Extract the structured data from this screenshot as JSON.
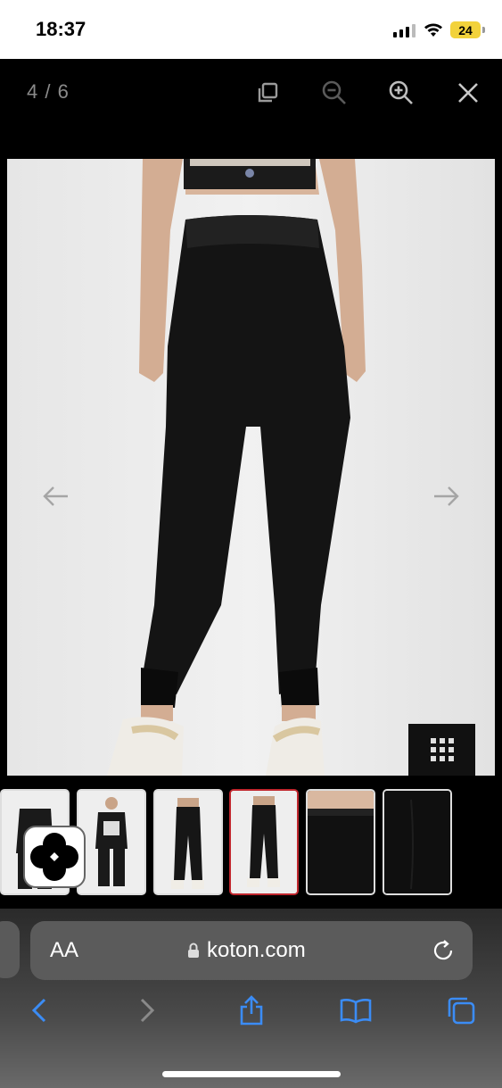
{
  "status_bar": {
    "time": "18:37",
    "battery": "24"
  },
  "lightbox": {
    "counter": "4 / 6",
    "buttons": [
      "copy-icon",
      "zoom-out-icon",
      "zoom-in-icon",
      "close-icon"
    ]
  },
  "gallery": {
    "active_index": 4,
    "thumbnail_count": 6
  },
  "safari": {
    "text_size_label": "AA",
    "url": "koton.com"
  },
  "colors": {
    "active_thumb_border": "#c0262d",
    "safari_accent": "#3b8cf5"
  }
}
